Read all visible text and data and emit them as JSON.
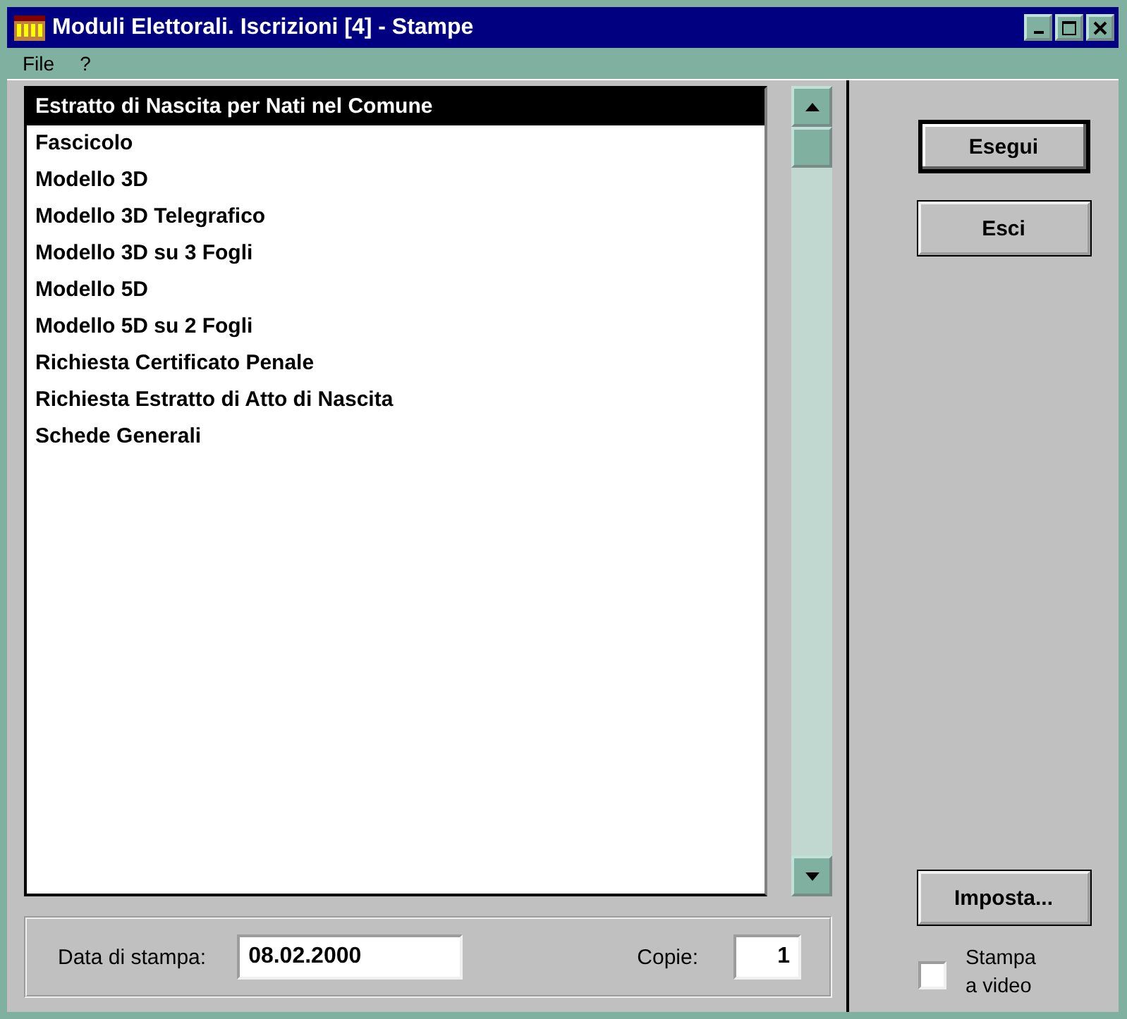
{
  "window": {
    "title": "Moduli Elettorali. Iscrizioni [4] - Stampe"
  },
  "menu": [
    {
      "label": "File"
    },
    {
      "label": "?"
    }
  ],
  "list": {
    "items": [
      {
        "label": "Estratto di Nascita per Nati nel Comune",
        "selected": true
      },
      {
        "label": "Fascicolo",
        "selected": false
      },
      {
        "label": "Modello 3D",
        "selected": false
      },
      {
        "label": "Modello 3D Telegrafico",
        "selected": false
      },
      {
        "label": "Modello 3D su 3 Fogli",
        "selected": false
      },
      {
        "label": "Modello 5D",
        "selected": false
      },
      {
        "label": "Modello 5D su 2 Fogli",
        "selected": false
      },
      {
        "label": "Richiesta Certificato Penale",
        "selected": false
      },
      {
        "label": "Richiesta Estratto di Atto di Nascita",
        "selected": false
      },
      {
        "label": "Schede Generali",
        "selected": false
      }
    ]
  },
  "print_date": {
    "label": "Data di stampa:",
    "value": "08.02.2000"
  },
  "copies": {
    "label": "Copie:",
    "value": "1"
  },
  "buttons": [
    {
      "label": "Esegui",
      "default": true
    },
    {
      "label": "Esci",
      "default": false
    }
  ],
  "setup_button": {
    "label": "Imposta..."
  },
  "preview_checkbox": {
    "label": "Stampa a video",
    "checked": false
  }
}
